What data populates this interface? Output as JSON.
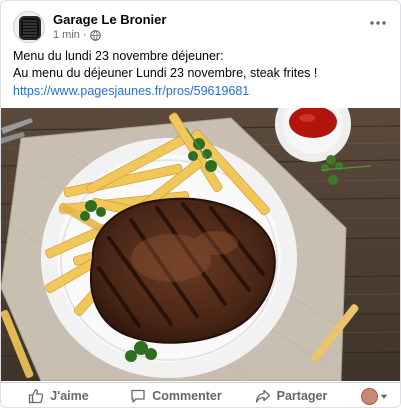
{
  "post": {
    "page_name": "Garage Le Bronier",
    "time": "1 min",
    "separator": "·",
    "audience_icon": "globe-icon",
    "more_icon": "more-options-icon",
    "message_line1": "Menu du lundi 23 novembre déjeuner:",
    "message_line2": "Au menu du déjeuner Lundi 23 novembre, steak frites !",
    "link": "https://www.pagesjaunes.fr/pros/59619681",
    "image_icon": "steak-frites-photo"
  },
  "actions": {
    "like_label": "J'aime",
    "comment_label": "Commenter",
    "share_label": "Partager",
    "like_icon": "thumbs-up-icon",
    "comment_icon": "comment-icon",
    "share_icon": "share-icon",
    "reactor_icon": "reaction-avatar",
    "dropdown_icon": "chevron-down-icon"
  },
  "colors": {
    "link": "#216fdb",
    "muted": "#65676b",
    "text": "#050505",
    "divider": "#ced0d4"
  }
}
